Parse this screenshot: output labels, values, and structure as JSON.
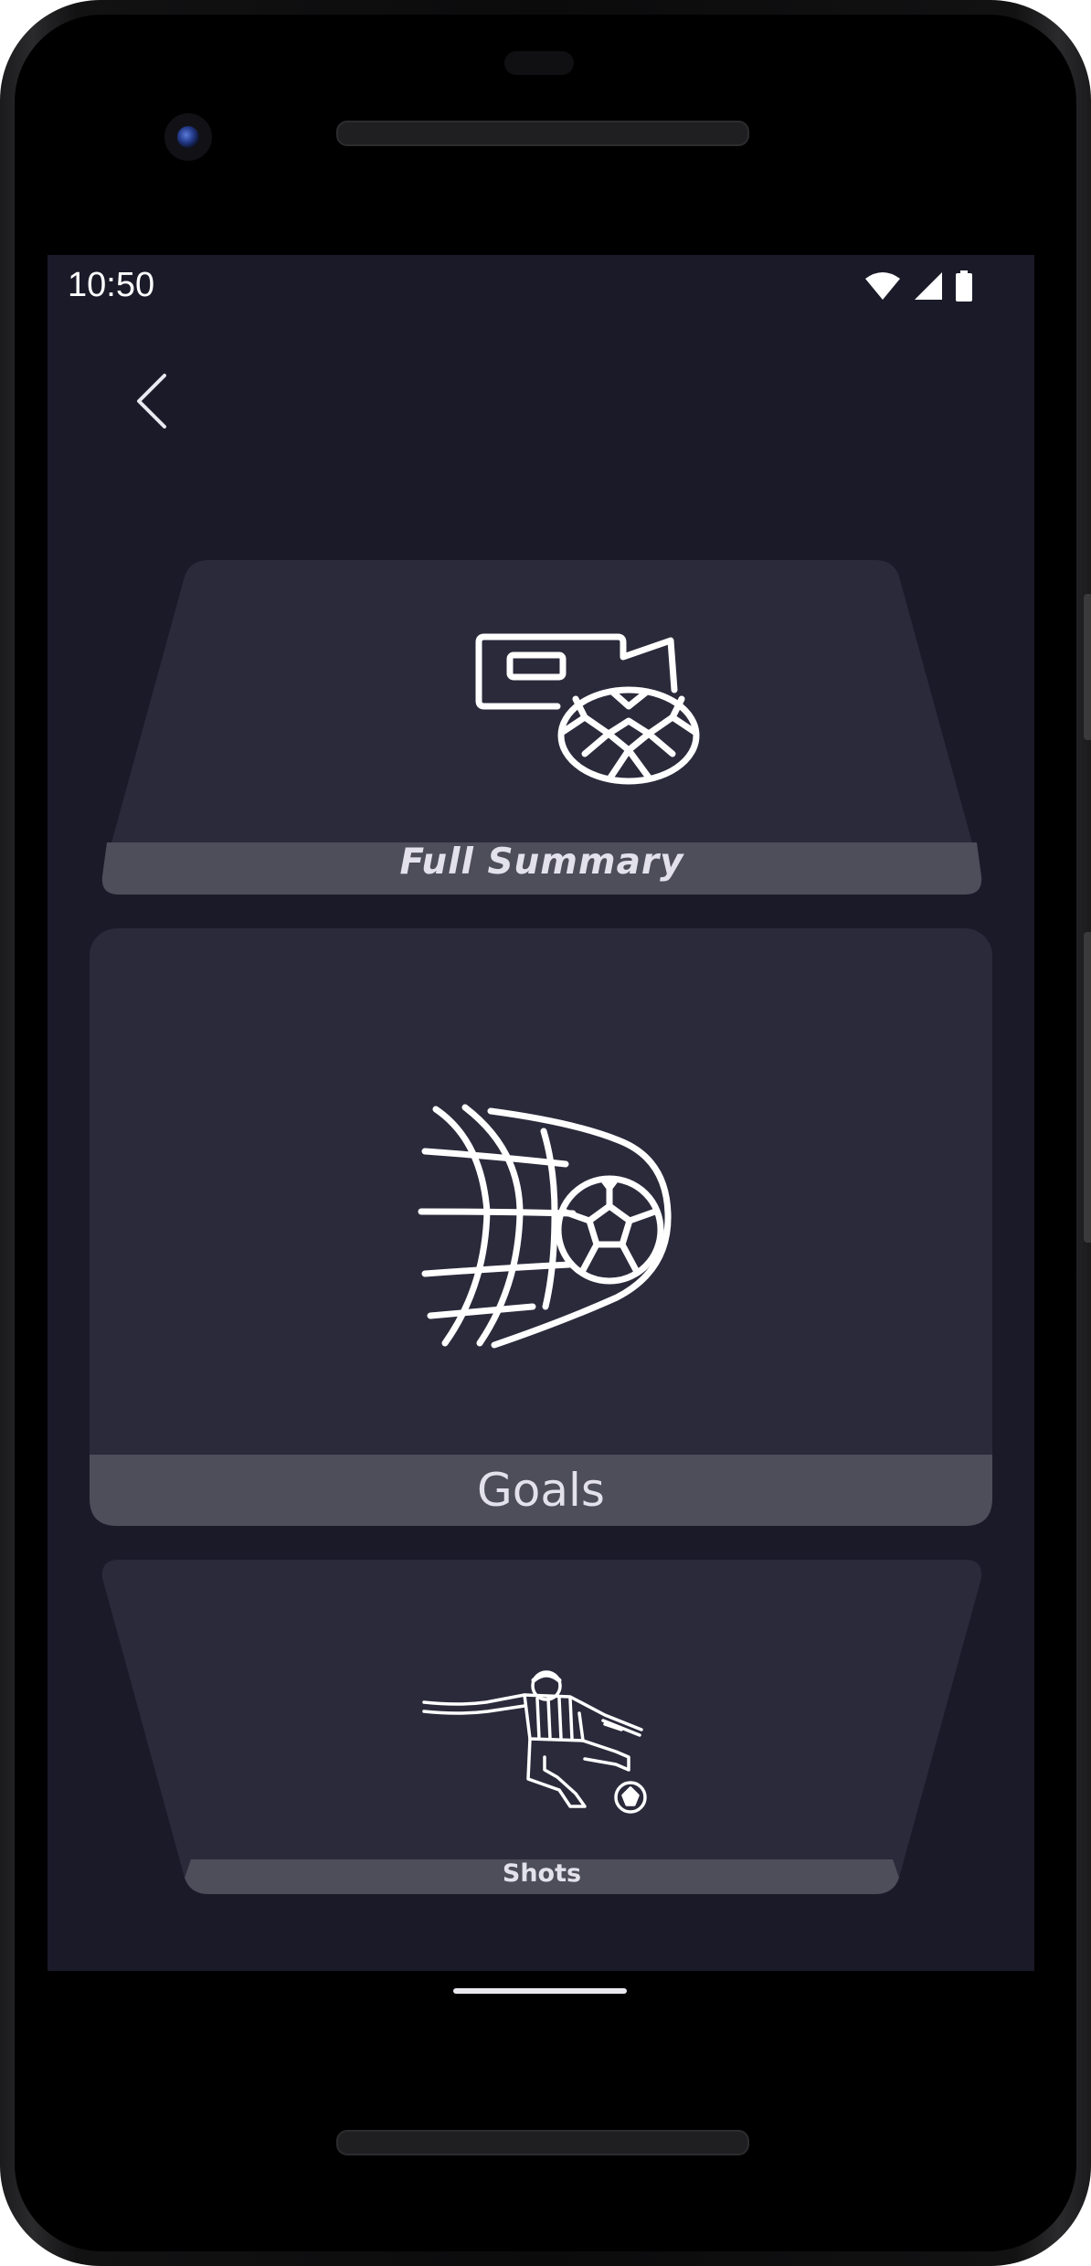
{
  "status_bar": {
    "time": "10:50",
    "icons": [
      "wifi-icon",
      "cell-signal-icon",
      "battery-icon"
    ]
  },
  "nav": {
    "back_icon": "chevron-left-icon"
  },
  "cards": [
    {
      "label": "Full Summary",
      "icon": "camera-football-icon"
    },
    {
      "label": "Goals",
      "icon": "football-net-icon"
    },
    {
      "label": "Shots",
      "icon": "player-kicking-icon"
    }
  ],
  "colors": {
    "screen_background": "#1b1a29",
    "card_background": "#2b2a3b",
    "label_band": "#4e4d5a",
    "label_text": "#e3e2ec",
    "icon_stroke": "#ffffff"
  }
}
